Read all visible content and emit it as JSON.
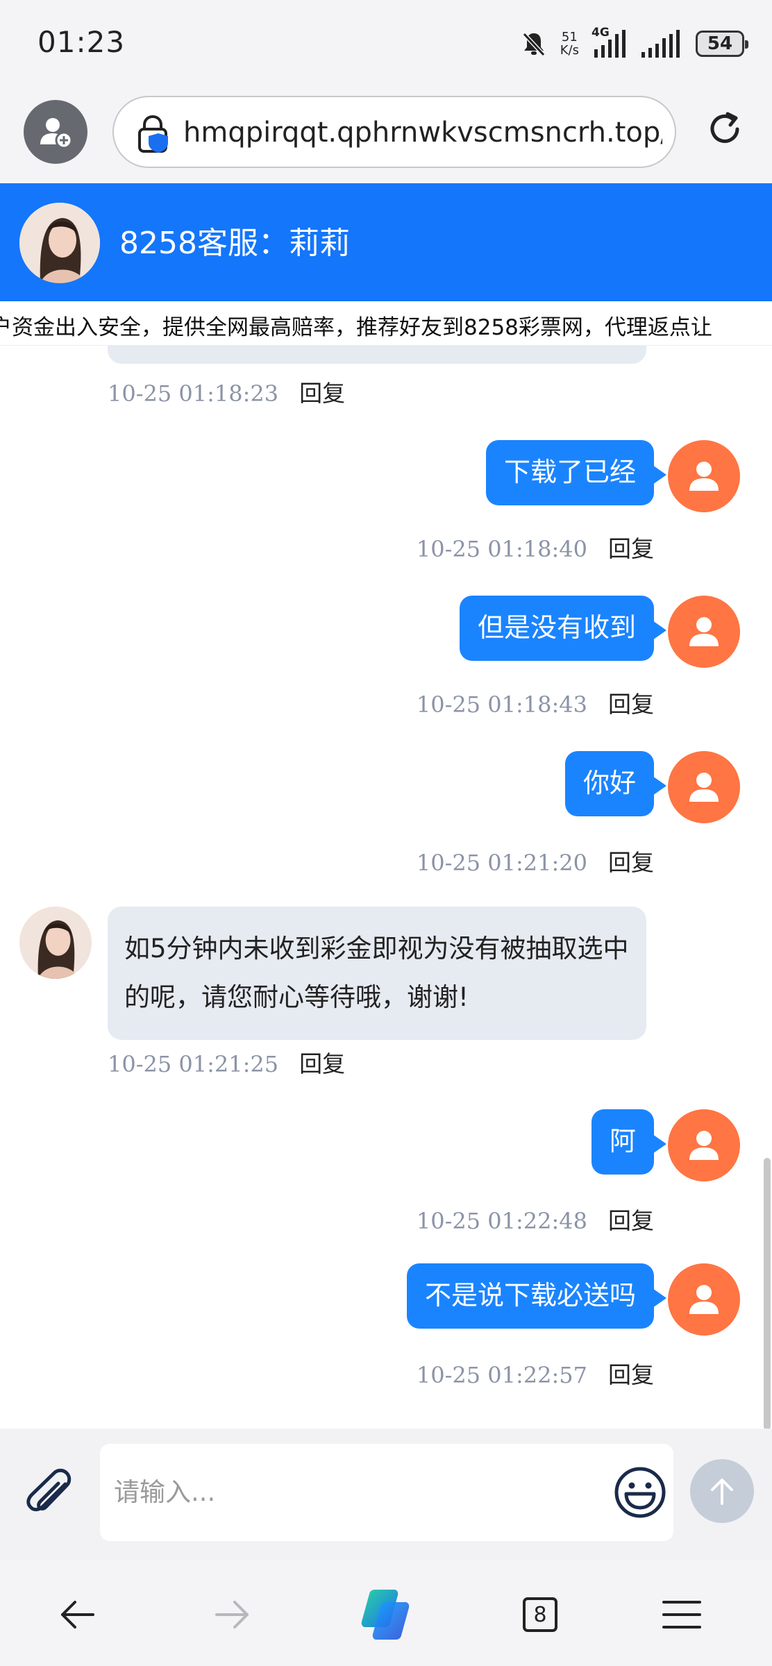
{
  "status_bar": {
    "time": "01:23",
    "speed_value": "51",
    "speed_unit": "K/s",
    "network": "4G",
    "battery": "54"
  },
  "browser": {
    "url": "hmqpirqqt.qphrnwkvscmsncrh.top/ac",
    "tab_count": "8"
  },
  "chat": {
    "title": "8258客服：莉莉",
    "marquee": "户资金出入安全，提供全网最高赔率，推荐好友到8258彩票网，代理返点让",
    "reply_label": "回复",
    "input_placeholder": "请输入...",
    "messages": [
      {
        "side": "in",
        "text": "",
        "time": "10-25 01:18:23"
      },
      {
        "side": "out",
        "text": "下载了已经",
        "time": "10-25 01:18:40"
      },
      {
        "side": "out",
        "text": "但是没有收到",
        "time": "10-25 01:18:43"
      },
      {
        "side": "out",
        "text": "你好",
        "time": "10-25 01:21:20"
      },
      {
        "side": "in",
        "text": "如5分钟内未收到彩金即视为没有被抽取选中的呢，请您耐心等待哦，谢谢!",
        "time": "10-25 01:21:25"
      },
      {
        "side": "out",
        "text": "阿",
        "time": "10-25 01:22:48"
      },
      {
        "side": "out",
        "text": "不是说下载必送吗",
        "time": "10-25 01:22:57"
      }
    ]
  },
  "colors": {
    "header_blue": "#1476fb",
    "bubble_blue": "#1a84ff",
    "user_avatar_orange": "#ff7543",
    "agent_bubble": "#e6eaf1"
  },
  "icons": {
    "mute": "bell-off-icon",
    "profile": "add-profile-icon",
    "lock": "secure-lock-icon",
    "reload": "reload-icon",
    "attach": "paperclip-icon",
    "emoji": "smiley-icon",
    "send": "arrow-up-icon",
    "back": "arrow-left-icon",
    "forward": "arrow-right-icon",
    "copilot": "copilot-logo-icon",
    "menu": "hamburger-menu-icon"
  }
}
